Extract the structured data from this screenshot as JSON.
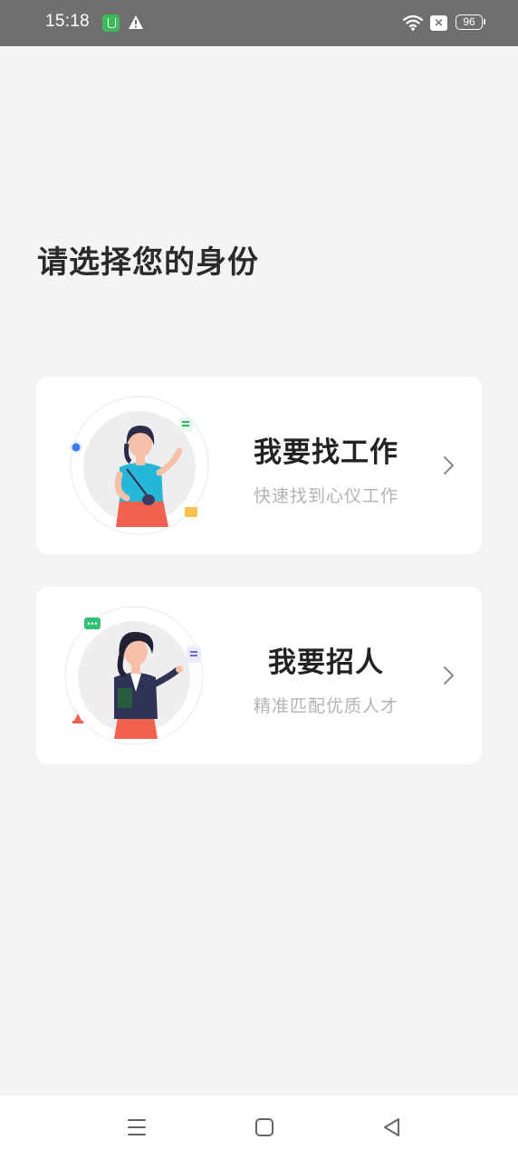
{
  "status_bar": {
    "time": "15:18",
    "icons": [
      "app-notification-icon",
      "warning-icon",
      "wifi-icon",
      "sim-icon",
      "battery-icon"
    ],
    "battery": "96"
  },
  "page": {
    "title": "请选择您的身份"
  },
  "roles": [
    {
      "title": "我要找工作",
      "subtitle": "快速找到心仪工作",
      "icon": "job-seeker-illustration"
    },
    {
      "title": "我要招人",
      "subtitle": "精准匹配优质人才",
      "icon": "recruiter-illustration"
    }
  ],
  "nav": {
    "icons": [
      "menu-icon",
      "home-icon",
      "back-icon"
    ]
  },
  "colors": {
    "background": "#f4f4f4",
    "card": "#ffffff",
    "status_bar": "#6f6f6f",
    "accent_green": "#3dbb5a"
  }
}
